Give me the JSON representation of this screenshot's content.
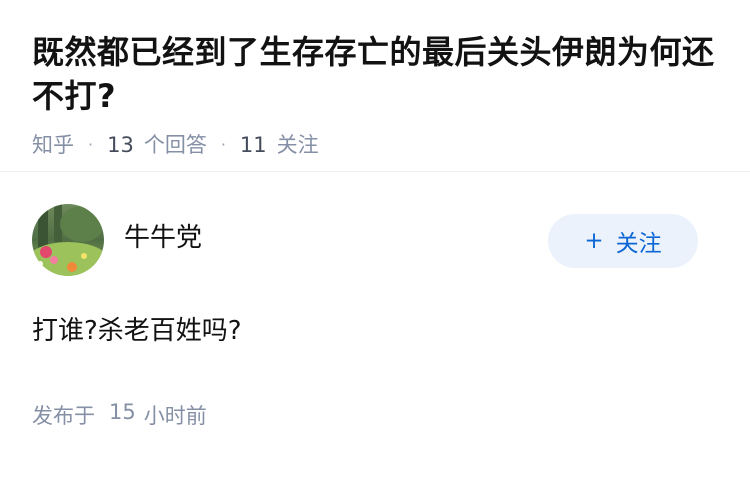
{
  "question": {
    "title": "既然都已经到了生存存亡的最后关头伊朗为何还不打?",
    "source": "知乎",
    "answer_count": "13",
    "answer_label": "个回答",
    "follow_count": "11",
    "follow_label": "关注"
  },
  "answer": {
    "author_name": "牛牛党",
    "follow_button_plus": "+",
    "follow_button_label": "关注",
    "content": "打谁?杀老百姓吗?",
    "published_label": "发布于",
    "published_num": "15",
    "published_unit": "小时前"
  },
  "colors": {
    "accent": "#0b66d6",
    "follow_bg": "#ebf2fb",
    "meta_text": "#8590a6"
  }
}
